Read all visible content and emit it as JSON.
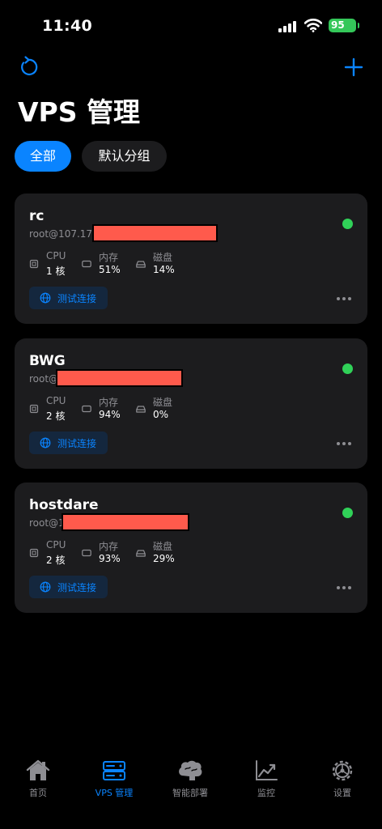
{
  "status_bar": {
    "time": "11:40",
    "battery": "95"
  },
  "header": {
    "title": "VPS 管理"
  },
  "filters": [
    {
      "label": "全部",
      "active": true
    },
    {
      "label": "默认分组",
      "active": false
    }
  ],
  "servers": [
    {
      "name": "rc",
      "address": "root@107.174.",
      "status": "online",
      "cpu": {
        "label": "CPU",
        "value": "1 核"
      },
      "memory": {
        "label": "内存",
        "value": "51%"
      },
      "disk": {
        "label": "磁盘",
        "value": "14%"
      },
      "test_label": "测试连接"
    },
    {
      "name": "BWG",
      "address": "root@",
      "status": "online",
      "cpu": {
        "label": "CPU",
        "value": "2 核"
      },
      "memory": {
        "label": "内存",
        "value": "94%"
      },
      "disk": {
        "label": "磁盘",
        "value": "0%"
      },
      "test_label": "测试连接"
    },
    {
      "name": "hostdare",
      "address": "root@1",
      "status": "online",
      "cpu": {
        "label": "CPU",
        "value": "2 核"
      },
      "memory": {
        "label": "内存",
        "value": "93%"
      },
      "disk": {
        "label": "磁盘",
        "value": "29%"
      },
      "test_label": "测试连接"
    }
  ],
  "tabs": [
    {
      "label": "首页",
      "icon": "home-icon",
      "active": false
    },
    {
      "label": "VPS 管理",
      "icon": "server-icon",
      "active": true
    },
    {
      "label": "智能部署",
      "icon": "brain-icon",
      "active": false
    },
    {
      "label": "监控",
      "icon": "chart-icon",
      "active": false
    },
    {
      "label": "设置",
      "icon": "gear-icon",
      "active": false
    }
  ],
  "colors": {
    "accent": "#0a84ff",
    "card": "#1c1c1e",
    "online": "#30d158",
    "redaction": "#ff5a4c"
  }
}
